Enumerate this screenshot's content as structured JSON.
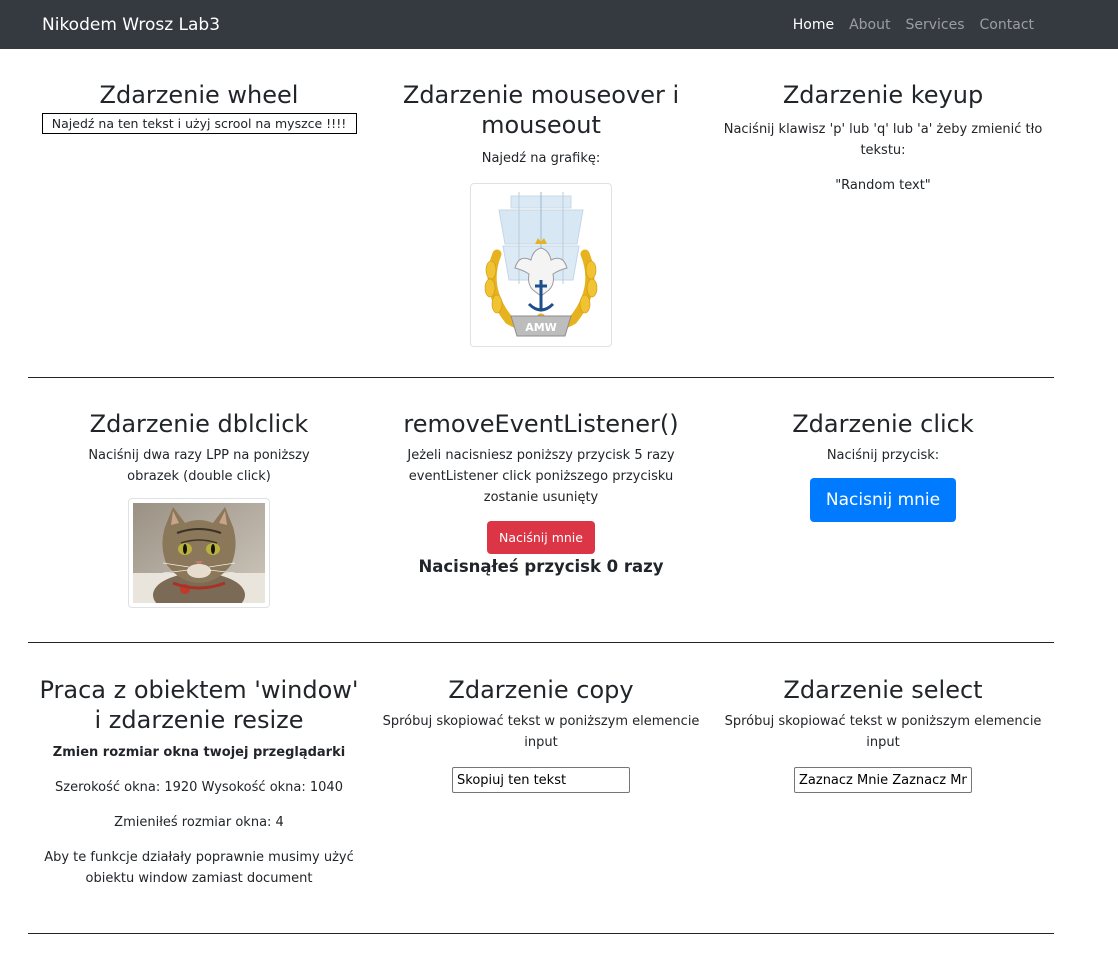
{
  "nav": {
    "brand": "Nikodem Wrosz Lab3",
    "links": [
      "Home",
      "About",
      "Services",
      "Contact"
    ],
    "active": "Home"
  },
  "wheel": {
    "title": "Zdarzenie wheel",
    "box_text": "Najedź na ten tekst i użyj scrool na myszce !!!!"
  },
  "mouse": {
    "title": "Zdarzenie mouseover i mouseout",
    "text": "Najedź na grafikę:",
    "logo_label": "AMW"
  },
  "keyup": {
    "title": "Zdarzenie keyup",
    "text": "Naciśnij klawisz 'p' lub 'q' lub 'a' żeby zmienić tło tekstu:",
    "random": "\"Random text\""
  },
  "dblclick": {
    "title": "Zdarzenie dblclick",
    "text": "Naciśnij dwa razy LPP na poniższy obrazek (double click)"
  },
  "remove": {
    "title": "removeEventListener()",
    "text": "Jeżeli nacisniesz poniższy przycisk 5 razy eventListener click poniższego przycisku zostanie usunięty",
    "button": "Naciśnij mnie",
    "counter": "Nacisnąłeś przycisk 0 razy"
  },
  "click": {
    "title": "Zdarzenie click",
    "text": "Naciśnij przycisk:",
    "button": "Nacisnij mnie"
  },
  "window": {
    "title": "Praca z obiektem 'window' i zdarzenie resize",
    "bold": "Zmien rozmiar okna twojej przeglądarki",
    "size": "Szerokość okna: 1920 Wysokość okna: 1040",
    "changed": "Zmieniłeś rozmiar okna: 4",
    "note": "Aby te funkcje działały poprawnie musimy użyć obiektu window zamiast document"
  },
  "copy": {
    "title": "Zdarzenie copy",
    "text": "Spróbuj skopiować tekst w poniższym elemencie input",
    "value": "Skopiuj ten tekst"
  },
  "select": {
    "title": "Zdarzenie select",
    "text": "Spróbuj skopiować tekst w poniższym elemencie input",
    "value": "Zaznacz Mnie Zaznacz Mnie"
  },
  "colors": {
    "navbar": "#343a40",
    "danger": "#dc3545",
    "primary": "#007bff"
  }
}
